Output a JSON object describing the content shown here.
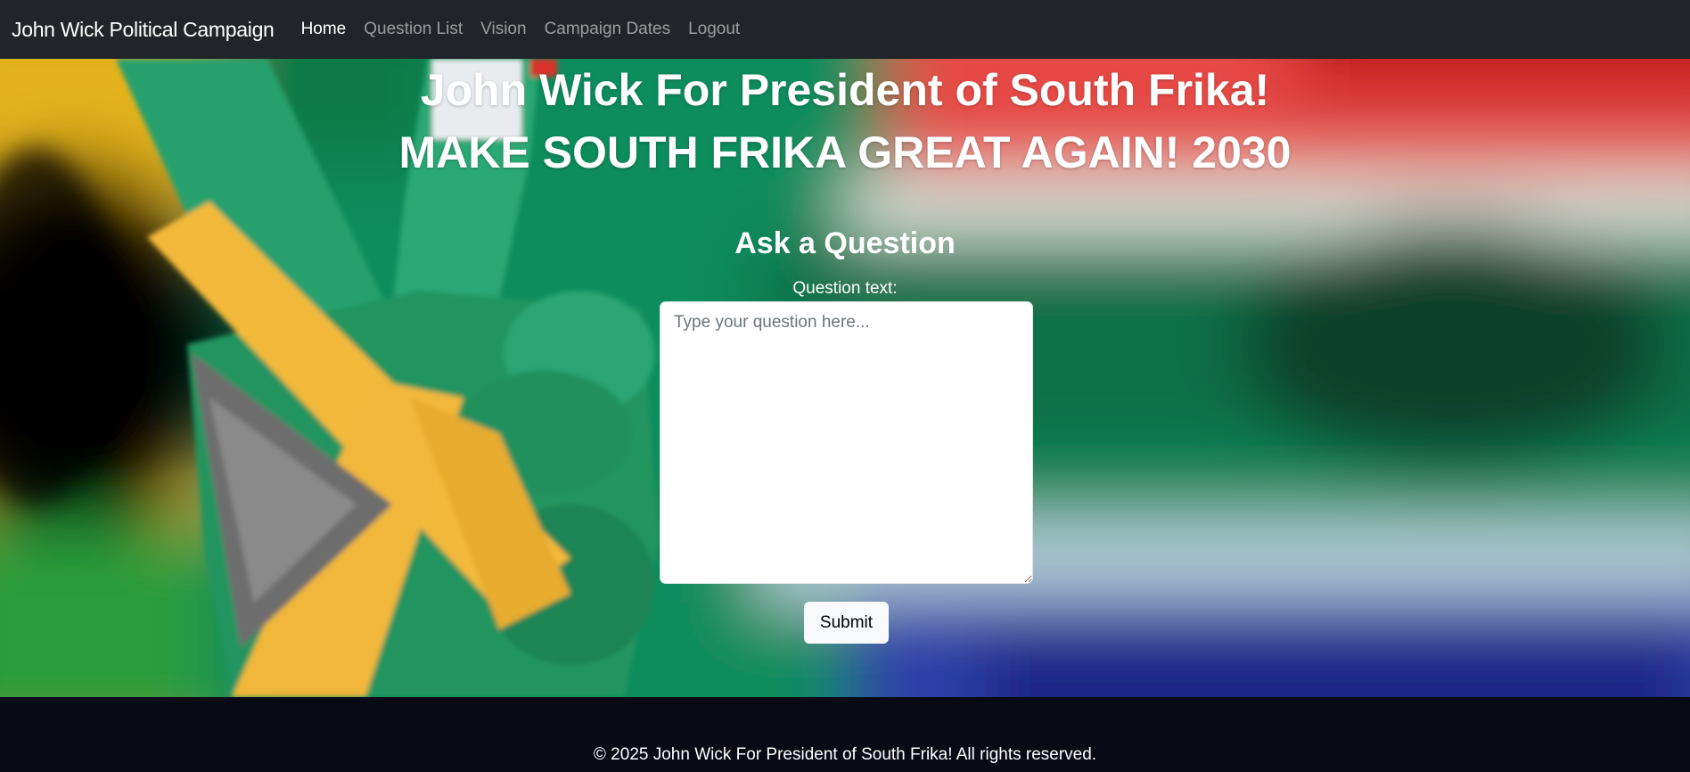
{
  "nav": {
    "brand": "John Wick Political Campaign",
    "links": [
      "Home",
      "Question List",
      "Vision",
      "Campaign Dates",
      "Logout"
    ],
    "active": "Home"
  },
  "hero": {
    "title_line1": "John Wick For President of South Frika!",
    "title_line2": "MAKE SOUTH FRIKA GREAT AGAIN! 2030"
  },
  "question_form": {
    "heading": "Ask a Question",
    "label": "Question text:",
    "placeholder": "Type your question here...",
    "value": "",
    "submit_label": "Submit"
  },
  "footer": {
    "text": "© 2025 John Wick For President of South Frika! All rights reserved."
  },
  "colors": {
    "navbar": "#212529",
    "flag_green": "#007a4d",
    "flag_yellow": "#f4b93c",
    "flag_red": "#de3831",
    "flag_blue": "#002395",
    "flag_black": "#000000"
  }
}
